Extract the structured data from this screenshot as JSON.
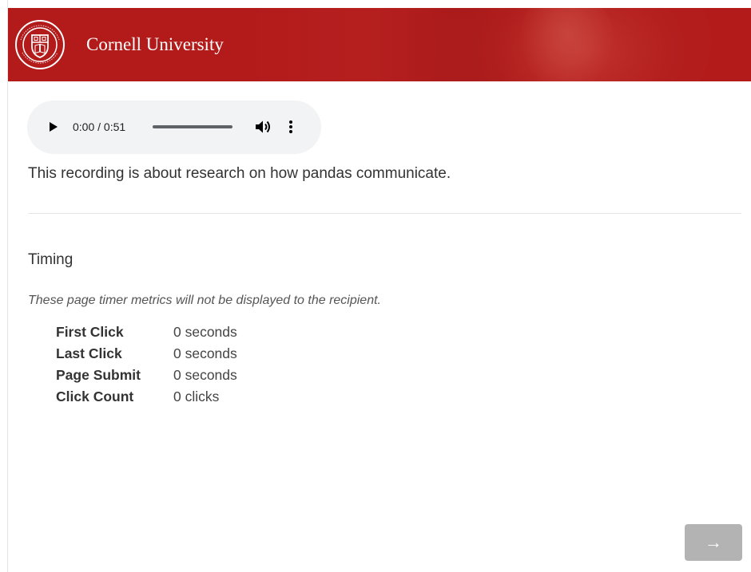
{
  "header": {
    "brand_name": "Cornell University",
    "background_color": "#b31b1b",
    "seal_icon": "cornell-seal-icon"
  },
  "audio": {
    "current_time": "0:00",
    "duration": "0:51",
    "time_display": "0:00 / 0:51",
    "progress": 0,
    "play_icon": "play-icon",
    "volume_icon": "volume-icon",
    "more_icon": "more-vertical-icon"
  },
  "question": {
    "description": "This recording is about research on how pandas communicate."
  },
  "timing": {
    "title": "Timing",
    "note": "These page timer metrics will not be displayed to the recipient.",
    "metrics": [
      {
        "label": "First Click",
        "value": "0 seconds"
      },
      {
        "label": "Last Click",
        "value": "0 seconds"
      },
      {
        "label": "Page Submit",
        "value": "0 seconds"
      },
      {
        "label": "Click Count",
        "value": "0 clicks"
      }
    ]
  },
  "navigation": {
    "next_label": "→",
    "next_color": "#b3b3b3"
  }
}
